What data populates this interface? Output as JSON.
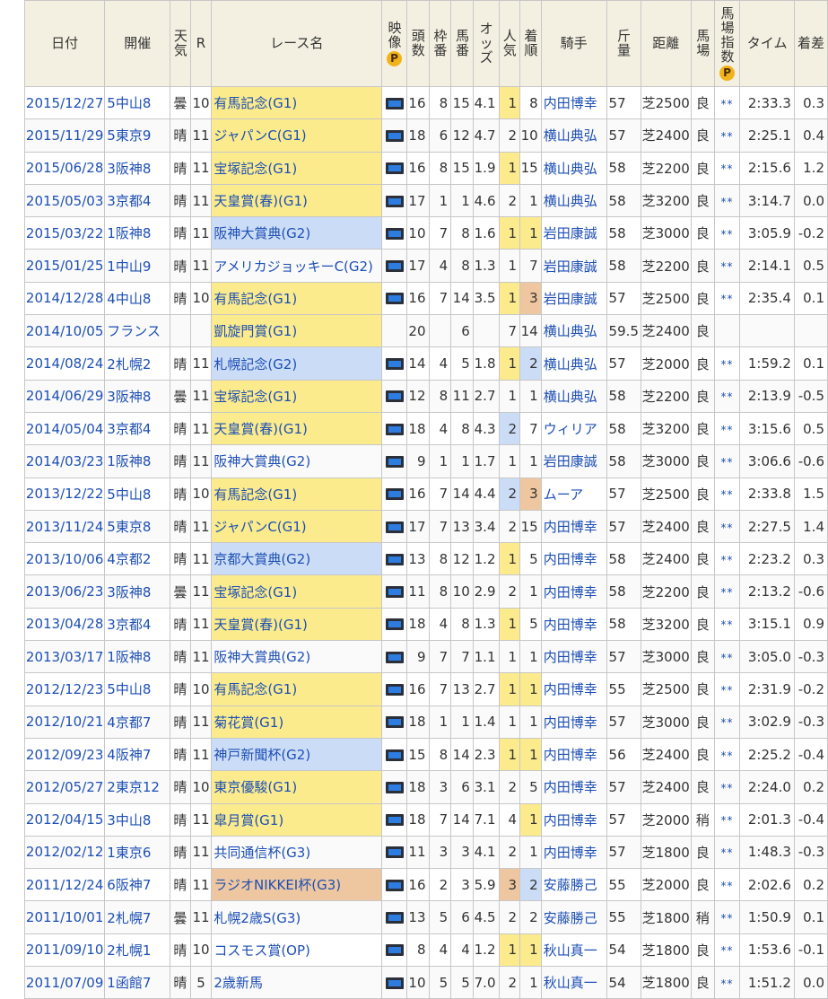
{
  "headers": {
    "date": "日付",
    "venue": "開催",
    "weather": "天気",
    "round": "R",
    "race_name": "レース名",
    "video": "映像",
    "runners": "頭数",
    "frame": "枠番",
    "horse_no": "馬番",
    "odds": "オッズ",
    "popularity": "人気",
    "finish": "着順",
    "jockey": "騎手",
    "weight": "斤量",
    "distance": "距離",
    "track": "馬場",
    "track_index": "馬場指数",
    "time": "タイム",
    "margin": "着差"
  },
  "badge_letter": "P",
  "colors": {
    "header_bg": "#f4f0e1",
    "grade_g1": "#fbeb8c",
    "grade_g2": "#cbdcf7",
    "grade_g3": "#eec7a0",
    "link": "#1d4fb5",
    "badge": "#f1b31b"
  },
  "rows": [
    {
      "date": "2015/12/27",
      "venue": "5中山8",
      "weather": "曇",
      "round": "10",
      "race_name": "有馬記念(G1)",
      "grade": "g1",
      "video": true,
      "runners": "16",
      "frame": "8",
      "horse_no": "15",
      "odds": "4.1",
      "popularity": "1",
      "finish": "8",
      "jockey": "内田博幸",
      "weight": "57",
      "distance": "芝2500",
      "track": "良",
      "track_index": "**",
      "time": "2:33.3",
      "margin": "0.3"
    },
    {
      "date": "2015/11/29",
      "venue": "5東京9",
      "weather": "晴",
      "round": "11",
      "race_name": "ジャパンC(G1)",
      "grade": "g1",
      "video": true,
      "runners": "18",
      "frame": "6",
      "horse_no": "12",
      "odds": "4.7",
      "popularity": "2",
      "finish": "10",
      "jockey": "横山典弘",
      "weight": "57",
      "distance": "芝2400",
      "track": "良",
      "track_index": "**",
      "time": "2:25.1",
      "margin": "0.4"
    },
    {
      "date": "2015/06/28",
      "venue": "3阪神8",
      "weather": "晴",
      "round": "11",
      "race_name": "宝塚記念(G1)",
      "grade": "g1",
      "video": true,
      "runners": "16",
      "frame": "8",
      "horse_no": "15",
      "odds": "1.9",
      "popularity": "1",
      "finish": "15",
      "jockey": "横山典弘",
      "weight": "58",
      "distance": "芝2200",
      "track": "良",
      "track_index": "**",
      "time": "2:15.6",
      "margin": "1.2"
    },
    {
      "date": "2015/05/03",
      "venue": "3京都4",
      "weather": "晴",
      "round": "11",
      "race_name": "天皇賞(春)(G1)",
      "grade": "g1",
      "video": true,
      "runners": "17",
      "frame": "1",
      "horse_no": "1",
      "odds": "4.6",
      "popularity": "2",
      "finish": "1",
      "jockey": "横山典弘",
      "weight": "58",
      "distance": "芝3200",
      "track": "良",
      "track_index": "**",
      "time": "3:14.7",
      "margin": "0.0"
    },
    {
      "date": "2015/03/22",
      "venue": "1阪神8",
      "weather": "晴",
      "round": "11",
      "race_name": "阪神大賞典(G2)",
      "grade": "g2",
      "video": true,
      "runners": "10",
      "frame": "7",
      "horse_no": "8",
      "odds": "1.6",
      "popularity": "1",
      "finish": "1",
      "jockey": "岩田康誠",
      "weight": "58",
      "distance": "芝3000",
      "track": "良",
      "track_index": "**",
      "time": "3:05.9",
      "margin": "-0.2"
    },
    {
      "date": "2015/01/25",
      "venue": "1中山9",
      "weather": "晴",
      "round": "11",
      "race_name": "アメリカジョッキーC(G2)",
      "grade": "g2",
      "video": true,
      "runners": "17",
      "frame": "4",
      "horse_no": "8",
      "odds": "1.3",
      "popularity": "1",
      "finish": "7",
      "jockey": "岩田康誠",
      "weight": "58",
      "distance": "芝2200",
      "track": "良",
      "track_index": "**",
      "time": "2:14.1",
      "margin": "0.5"
    },
    {
      "date": "2014/12/28",
      "venue": "4中山8",
      "weather": "晴",
      "round": "10",
      "race_name": "有馬記念(G1)",
      "grade": "g1",
      "video": true,
      "runners": "16",
      "frame": "7",
      "horse_no": "14",
      "odds": "3.5",
      "popularity": "1",
      "finish": "3",
      "jockey": "岩田康誠",
      "weight": "57",
      "distance": "芝2500",
      "track": "良",
      "track_index": "**",
      "time": "2:35.4",
      "margin": "0.1"
    },
    {
      "date": "2014/10/05",
      "venue": "フランス",
      "weather": "",
      "round": "",
      "race_name": "凱旋門賞(G1)",
      "grade": "g1",
      "video": false,
      "runners": "20",
      "frame": "",
      "horse_no": "6",
      "odds": "",
      "popularity": "7",
      "finish": "14",
      "jockey": "横山典弘",
      "weight": "59.5",
      "distance": "芝2400",
      "track": "良",
      "track_index": "",
      "time": "",
      "margin": ""
    },
    {
      "date": "2014/08/24",
      "venue": "2札幌2",
      "weather": "晴",
      "round": "11",
      "race_name": "札幌記念(G2)",
      "grade": "g2",
      "video": true,
      "runners": "14",
      "frame": "4",
      "horse_no": "5",
      "odds": "1.8",
      "popularity": "1",
      "finish": "2",
      "jockey": "横山典弘",
      "weight": "57",
      "distance": "芝2000",
      "track": "良",
      "track_index": "**",
      "time": "1:59.2",
      "margin": "0.1"
    },
    {
      "date": "2014/06/29",
      "venue": "3阪神8",
      "weather": "曇",
      "round": "11",
      "race_name": "宝塚記念(G1)",
      "grade": "g1",
      "video": true,
      "runners": "12",
      "frame": "8",
      "horse_no": "11",
      "odds": "2.7",
      "popularity": "1",
      "finish": "1",
      "jockey": "横山典弘",
      "weight": "58",
      "distance": "芝2200",
      "track": "良",
      "track_index": "**",
      "time": "2:13.9",
      "margin": "-0.5"
    },
    {
      "date": "2014/05/04",
      "venue": "3京都4",
      "weather": "晴",
      "round": "11",
      "race_name": "天皇賞(春)(G1)",
      "grade": "g1",
      "video": true,
      "runners": "18",
      "frame": "4",
      "horse_no": "8",
      "odds": "4.3",
      "popularity": "2",
      "finish": "7",
      "jockey": "ウィリア",
      "weight": "58",
      "distance": "芝3200",
      "track": "良",
      "track_index": "**",
      "time": "3:15.6",
      "margin": "0.5"
    },
    {
      "date": "2014/03/23",
      "venue": "1阪神8",
      "weather": "晴",
      "round": "11",
      "race_name": "阪神大賞典(G2)",
      "grade": "g2",
      "video": true,
      "runners": "9",
      "frame": "1",
      "horse_no": "1",
      "odds": "1.7",
      "popularity": "1",
      "finish": "1",
      "jockey": "岩田康誠",
      "weight": "58",
      "distance": "芝3000",
      "track": "良",
      "track_index": "**",
      "time": "3:06.6",
      "margin": "-0.6"
    },
    {
      "date": "2013/12/22",
      "venue": "5中山8",
      "weather": "晴",
      "round": "10",
      "race_name": "有馬記念(G1)",
      "grade": "g1",
      "video": true,
      "runners": "16",
      "frame": "7",
      "horse_no": "14",
      "odds": "4.4",
      "popularity": "2",
      "finish": "3",
      "jockey": "ムーア",
      "weight": "57",
      "distance": "芝2500",
      "track": "良",
      "track_index": "**",
      "time": "2:33.8",
      "margin": "1.5"
    },
    {
      "date": "2013/11/24",
      "venue": "5東京8",
      "weather": "晴",
      "round": "11",
      "race_name": "ジャパンC(G1)",
      "grade": "g1",
      "video": true,
      "runners": "17",
      "frame": "7",
      "horse_no": "13",
      "odds": "3.4",
      "popularity": "2",
      "finish": "15",
      "jockey": "内田博幸",
      "weight": "57",
      "distance": "芝2400",
      "track": "良",
      "track_index": "**",
      "time": "2:27.5",
      "margin": "1.4"
    },
    {
      "date": "2013/10/06",
      "venue": "4京都2",
      "weather": "晴",
      "round": "11",
      "race_name": "京都大賞典(G2)",
      "grade": "g2",
      "video": true,
      "runners": "13",
      "frame": "8",
      "horse_no": "12",
      "odds": "1.2",
      "popularity": "1",
      "finish": "5",
      "jockey": "内田博幸",
      "weight": "58",
      "distance": "芝2400",
      "track": "良",
      "track_index": "**",
      "time": "2:23.2",
      "margin": "0.3"
    },
    {
      "date": "2013/06/23",
      "venue": "3阪神8",
      "weather": "曇",
      "round": "11",
      "race_name": "宝塚記念(G1)",
      "grade": "g1",
      "video": true,
      "runners": "11",
      "frame": "8",
      "horse_no": "10",
      "odds": "2.9",
      "popularity": "2",
      "finish": "1",
      "jockey": "内田博幸",
      "weight": "58",
      "distance": "芝2200",
      "track": "良",
      "track_index": "**",
      "time": "2:13.2",
      "margin": "-0.6"
    },
    {
      "date": "2013/04/28",
      "venue": "3京都4",
      "weather": "晴",
      "round": "11",
      "race_name": "天皇賞(春)(G1)",
      "grade": "g1",
      "video": true,
      "runners": "18",
      "frame": "4",
      "horse_no": "8",
      "odds": "1.3",
      "popularity": "1",
      "finish": "5",
      "jockey": "内田博幸",
      "weight": "58",
      "distance": "芝3200",
      "track": "良",
      "track_index": "**",
      "time": "3:15.1",
      "margin": "0.9"
    },
    {
      "date": "2013/03/17",
      "venue": "1阪神8",
      "weather": "晴",
      "round": "11",
      "race_name": "阪神大賞典(G2)",
      "grade": "g2",
      "video": true,
      "runners": "9",
      "frame": "7",
      "horse_no": "7",
      "odds": "1.1",
      "popularity": "1",
      "finish": "1",
      "jockey": "内田博幸",
      "weight": "57",
      "distance": "芝3000",
      "track": "良",
      "track_index": "**",
      "time": "3:05.0",
      "margin": "-0.3"
    },
    {
      "date": "2012/12/23",
      "venue": "5中山8",
      "weather": "晴",
      "round": "10",
      "race_name": "有馬記念(G1)",
      "grade": "g1",
      "video": true,
      "runners": "16",
      "frame": "7",
      "horse_no": "13",
      "odds": "2.7",
      "popularity": "1",
      "finish": "1",
      "jockey": "内田博幸",
      "weight": "55",
      "distance": "芝2500",
      "track": "良",
      "track_index": "**",
      "time": "2:31.9",
      "margin": "-0.2"
    },
    {
      "date": "2012/10/21",
      "venue": "4京都7",
      "weather": "晴",
      "round": "11",
      "race_name": "菊花賞(G1)",
      "grade": "g1",
      "video": true,
      "runners": "18",
      "frame": "1",
      "horse_no": "1",
      "odds": "1.4",
      "popularity": "1",
      "finish": "1",
      "jockey": "内田博幸",
      "weight": "57",
      "distance": "芝3000",
      "track": "良",
      "track_index": "**",
      "time": "3:02.9",
      "margin": "-0.3"
    },
    {
      "date": "2012/09/23",
      "venue": "4阪神7",
      "weather": "晴",
      "round": "11",
      "race_name": "神戸新聞杯(G2)",
      "grade": "g2",
      "video": true,
      "runners": "15",
      "frame": "8",
      "horse_no": "14",
      "odds": "2.3",
      "popularity": "1",
      "finish": "1",
      "jockey": "内田博幸",
      "weight": "56",
      "distance": "芝2400",
      "track": "良",
      "track_index": "**",
      "time": "2:25.2",
      "margin": "-0.4"
    },
    {
      "date": "2012/05/27",
      "venue": "2東京12",
      "weather": "晴",
      "round": "10",
      "race_name": "東京優駿(G1)",
      "grade": "g1",
      "video": true,
      "runners": "18",
      "frame": "3",
      "horse_no": "6",
      "odds": "3.1",
      "popularity": "2",
      "finish": "5",
      "jockey": "内田博幸",
      "weight": "57",
      "distance": "芝2400",
      "track": "良",
      "track_index": "**",
      "time": "2:24.0",
      "margin": "0.2"
    },
    {
      "date": "2012/04/15",
      "venue": "3中山8",
      "weather": "晴",
      "round": "11",
      "race_name": "皐月賞(G1)",
      "grade": "g1",
      "video": true,
      "runners": "18",
      "frame": "7",
      "horse_no": "14",
      "odds": "7.1",
      "popularity": "4",
      "finish": "1",
      "jockey": "内田博幸",
      "weight": "57",
      "distance": "芝2000",
      "track": "稍",
      "track_index": "**",
      "time": "2:01.3",
      "margin": "-0.4"
    },
    {
      "date": "2012/02/12",
      "venue": "1東京6",
      "weather": "晴",
      "round": "11",
      "race_name": "共同通信杯(G3)",
      "grade": "g3",
      "video": true,
      "runners": "11",
      "frame": "3",
      "horse_no": "3",
      "odds": "4.1",
      "popularity": "2",
      "finish": "1",
      "jockey": "内田博幸",
      "weight": "57",
      "distance": "芝1800",
      "track": "良",
      "track_index": "**",
      "time": "1:48.3",
      "margin": "-0.3"
    },
    {
      "date": "2011/12/24",
      "venue": "6阪神7",
      "weather": "晴",
      "round": "11",
      "race_name": "ラジオNIKKEI杯(G3)",
      "grade": "g3",
      "video": true,
      "runners": "16",
      "frame": "2",
      "horse_no": "3",
      "odds": "5.9",
      "popularity": "3",
      "finish": "2",
      "jockey": "安藤勝己",
      "weight": "55",
      "distance": "芝2000",
      "track": "良",
      "track_index": "**",
      "time": "2:02.6",
      "margin": "0.2"
    },
    {
      "date": "2011/10/01",
      "venue": "2札幌7",
      "weather": "曇",
      "round": "11",
      "race_name": "札幌2歳S(G3)",
      "grade": "g3",
      "video": true,
      "runners": "13",
      "frame": "5",
      "horse_no": "6",
      "odds": "4.5",
      "popularity": "2",
      "finish": "2",
      "jockey": "安藤勝己",
      "weight": "55",
      "distance": "芝1800",
      "track": "稍",
      "track_index": "**",
      "time": "1:50.9",
      "margin": "0.1"
    },
    {
      "date": "2011/09/10",
      "venue": "2札幌1",
      "weather": "晴",
      "round": "10",
      "race_name": "コスモス賞(OP)",
      "grade": "op",
      "video": true,
      "runners": "8",
      "frame": "4",
      "horse_no": "4",
      "odds": "1.2",
      "popularity": "1",
      "finish": "1",
      "jockey": "秋山真一",
      "weight": "54",
      "distance": "芝1800",
      "track": "良",
      "track_index": "**",
      "time": "1:53.6",
      "margin": "-0.1"
    },
    {
      "date": "2011/07/09",
      "venue": "1函館7",
      "weather": "晴",
      "round": "5",
      "race_name": "2歳新馬",
      "grade": "op",
      "video": true,
      "runners": "10",
      "frame": "5",
      "horse_no": "5",
      "odds": "7.0",
      "popularity": "2",
      "finish": "1",
      "jockey": "秋山真一",
      "weight": "54",
      "distance": "芝1800",
      "track": "良",
      "track_index": "**",
      "time": "1:51.2",
      "margin": "0.0"
    }
  ]
}
